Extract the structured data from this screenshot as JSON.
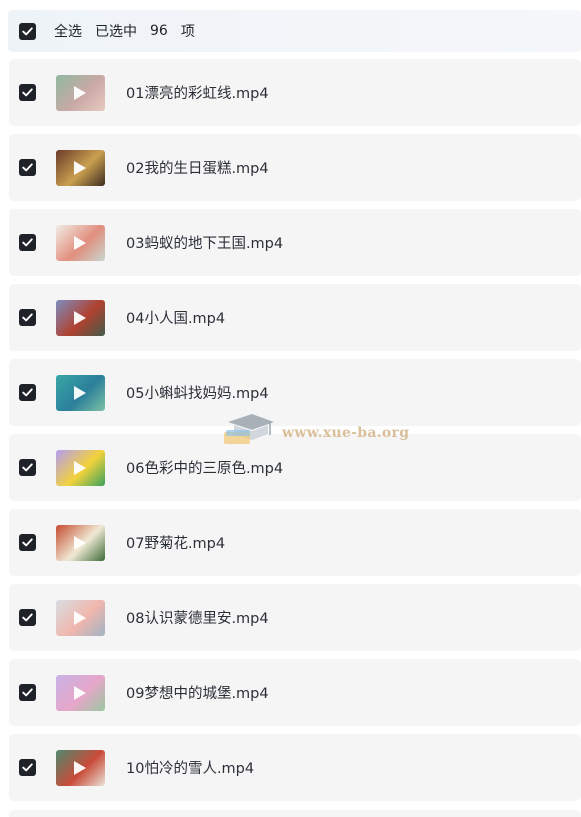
{
  "header": {
    "select_all_label": "全选",
    "selected_prefix": "已选中",
    "selected_count": "96",
    "selected_suffix": "项",
    "checked": true
  },
  "files": [
    {
      "name": "01漂亮的彩虹线.mp4",
      "checked": true,
      "thumb_colors": [
        "#8fb9a0",
        "#c9a9a6",
        "#e7c9c0"
      ]
    },
    {
      "name": "02我的生日蛋糕.mp4",
      "checked": true,
      "thumb_colors": [
        "#6b3a2a",
        "#c9a050",
        "#3d2b20"
      ]
    },
    {
      "name": "03蚂蚁的地下王国.mp4",
      "checked": true,
      "thumb_colors": [
        "#f1ede6",
        "#e28f7f",
        "#c8d7cf"
      ]
    },
    {
      "name": "04小人国.mp4",
      "checked": true,
      "thumb_colors": [
        "#7d8fc0",
        "#b04130",
        "#425a4a"
      ]
    },
    {
      "name": "05小蝌蚪找妈妈.mp4",
      "checked": true,
      "thumb_colors": [
        "#3aa7a6",
        "#2b7f9b",
        "#7dc3a5"
      ]
    },
    {
      "name": "06色彩中的三原色.mp4",
      "checked": true,
      "thumb_colors": [
        "#b49cf1",
        "#f3d23c",
        "#3aa25c"
      ]
    },
    {
      "name": "07野菊花.mp4",
      "checked": true,
      "thumb_colors": [
        "#c44a2f",
        "#f0e9d4",
        "#3d6a38"
      ]
    },
    {
      "name": "08认识蒙德里安.mp4",
      "checked": true,
      "thumb_colors": [
        "#d8dde2",
        "#f0b7ad",
        "#9fb3c4"
      ]
    },
    {
      "name": "09梦想中的城堡.mp4",
      "checked": true,
      "thumb_colors": [
        "#c8b3e7",
        "#e6a6c9",
        "#9bc7a0"
      ]
    },
    {
      "name": "10怕冷的雪人.mp4",
      "checked": true,
      "thumb_colors": [
        "#4d8a6e",
        "#c94b3a",
        "#e9e4d6"
      ]
    }
  ],
  "watermark": {
    "text": "www.xue-ba.org",
    "icon": "graduation-cap-icon"
  },
  "colors": {
    "checkbox": "#1f2329",
    "row_bg": "#f5f5f6",
    "text": "#2b2f36"
  }
}
